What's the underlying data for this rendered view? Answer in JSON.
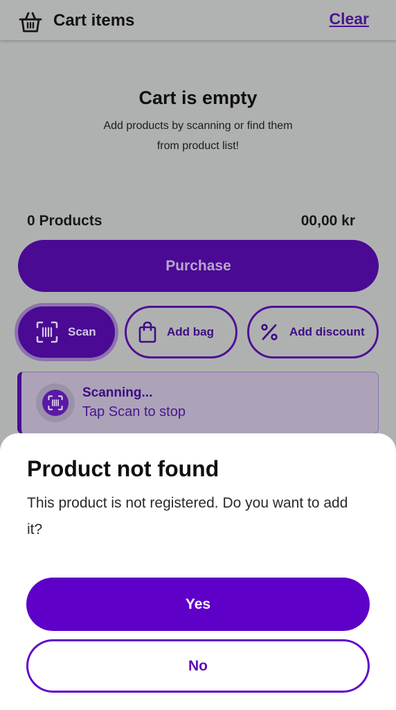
{
  "header": {
    "title": "Cart items",
    "clear_label": "Clear",
    "icon": "basket-icon"
  },
  "empty_state": {
    "title": "Cart is empty",
    "subtitle": "Add products by scanning or find them from product list!"
  },
  "summary": {
    "products_count": "0 Products",
    "total": "00,00 kr"
  },
  "actions": {
    "purchase_label": "Purchase",
    "scan_label": "Scan",
    "add_bag_label": "Add bag",
    "add_discount_label": "Add discount"
  },
  "scan_banner": {
    "title": "Scanning...",
    "subtitle": "Tap Scan to stop"
  },
  "dialog": {
    "title": "Product not found",
    "message": "This product is not registered. Do you want to add it?",
    "yes_label": "Yes",
    "no_label": "No"
  },
  "colors": {
    "primary": "#5f00c9",
    "primary_dimmed": "#4a0a94",
    "overlay_background": "#afb1b0",
    "sheet_background": "#ffffff"
  }
}
